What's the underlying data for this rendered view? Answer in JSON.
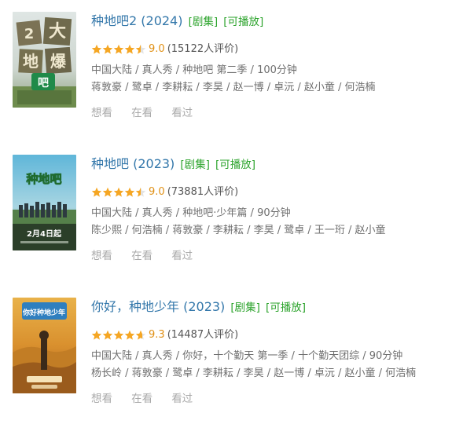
{
  "items": [
    {
      "title": "种地吧2 (2024)",
      "tag_series": "[剧集]",
      "tag_play": "[可播放]",
      "rating": 9.0,
      "rating_text": "9.0",
      "count": "(15122人评价)",
      "meta1": "中国大陆 / 真人秀 / 种地吧 第二季 / 100分钟",
      "meta2": "蒋敦豪 / 鹭卓 / 李耕耘 / 李昊 / 赵一博 / 卓沅 / 赵小童 / 何浩楠",
      "actions": [
        "想看",
        "在看",
        "看过"
      ],
      "poster_text": [
        "2",
        "大",
        "地",
        "爆",
        "吧"
      ]
    },
    {
      "title": "种地吧 (2023)",
      "tag_series": "[剧集]",
      "tag_play": "[可播放]",
      "rating": 9.0,
      "rating_text": "9.0",
      "count": "(73881人评价)",
      "meta1": "中国大陆 / 真人秀 / 种地吧·少年篇 / 90分钟",
      "meta2": "陈少熙 / 何浩楠 / 蒋敦豪 / 李耕耘 / 李昊 / 鹭卓 / 王一珩 / 赵小童",
      "actions": [
        "想看",
        "在看",
        "看过"
      ],
      "poster_text": [
        "种地吧",
        "2月4日起"
      ]
    },
    {
      "title": "你好，种地少年 (2023)",
      "tag_series": "[剧集]",
      "tag_play": "[可播放]",
      "rating": 9.3,
      "rating_text": "9.3",
      "count": "(14487人评价)",
      "meta1": "中国大陆 / 真人秀 / 你好，十个勤天 第一季 / 十个勤天团综 / 90分钟",
      "meta2": "杨长岭 / 蒋敦豪 / 鹭卓 / 李耕耘 / 李昊 / 赵一博 / 卓沅 / 赵小童 / 何浩楠",
      "actions": [
        "想看",
        "在看",
        "看过"
      ],
      "poster_text": [
        "你好种地少年"
      ]
    }
  ],
  "colors": {
    "title": "#3377aa",
    "tag": "#2ba32b",
    "star": "#f5a623",
    "score": "#e09015",
    "meta": "#6f6f6f",
    "action": "#aaaaaa"
  }
}
